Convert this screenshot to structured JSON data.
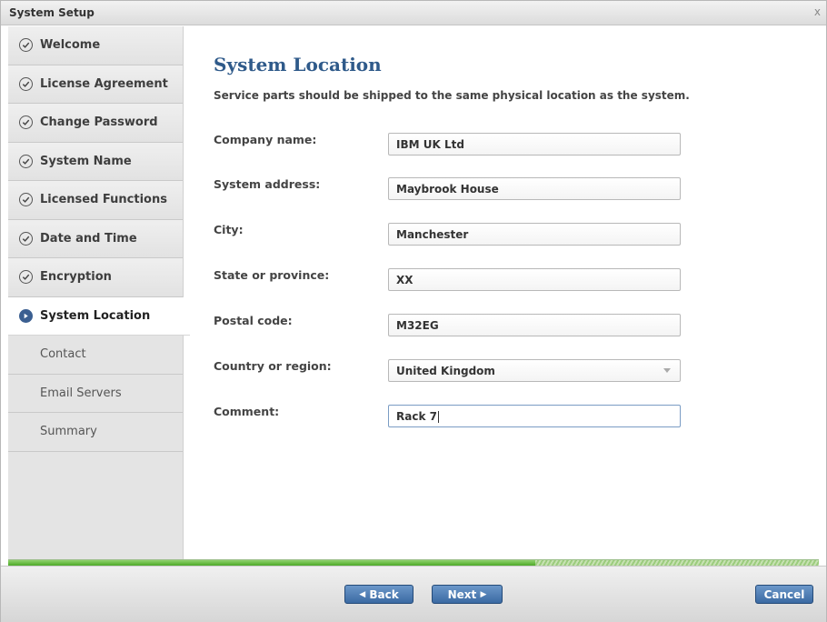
{
  "window": {
    "title": "System Setup",
    "close_glyph": "x"
  },
  "sidebar": {
    "completed": [
      {
        "label": "Welcome",
        "icon": "check-circle-icon"
      },
      {
        "label": "License Agreement",
        "icon": "check-circle-icon"
      },
      {
        "label": "Change Password",
        "icon": "check-circle-icon"
      },
      {
        "label": "System Name",
        "icon": "check-circle-icon"
      },
      {
        "label": "Licensed Functions",
        "icon": "check-circle-icon"
      },
      {
        "label": "Date and Time",
        "icon": "check-circle-icon"
      },
      {
        "label": "Encryption",
        "icon": "check-circle-icon"
      }
    ],
    "current": {
      "label": "System Location",
      "icon": "arrow-circle-icon"
    },
    "upcoming": [
      {
        "label": "Contact"
      },
      {
        "label": "Email Servers"
      },
      {
        "label": "Summary"
      }
    ]
  },
  "page": {
    "title": "System Location",
    "subtitle": "Service parts should be shipped to the same physical location as the system."
  },
  "form": {
    "company": {
      "label": "Company name:",
      "value": "IBM UK Ltd"
    },
    "address": {
      "label": "System address:",
      "value": "Maybrook House"
    },
    "city": {
      "label": "City:",
      "value": "Manchester"
    },
    "state": {
      "label": "State or province:",
      "value": "XX"
    },
    "postal": {
      "label": "Postal code:",
      "value": "M32EG"
    },
    "country": {
      "label": "Country or region:",
      "value": "United Kingdom"
    },
    "comment": {
      "label": "Comment:",
      "value": "Rack 7"
    }
  },
  "progress": {
    "fraction": 0.65
  },
  "footer": {
    "back_label": "Back",
    "next_label": "Next",
    "cancel_label": "Cancel"
  },
  "colors": {
    "accent": "#2f5a8a",
    "button": "#3b6aa3",
    "progress": "#4da928"
  }
}
